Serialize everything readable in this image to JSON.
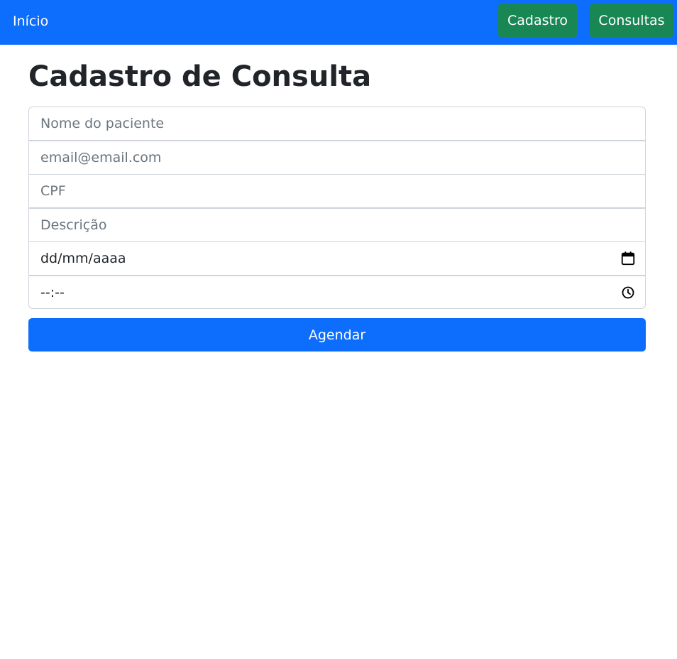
{
  "navbar": {
    "home_label": "Início",
    "cadastro_label": "Cadastro",
    "consultas_label": "Consultas",
    "background_color": "#0d6efd",
    "button_color": "#198754"
  },
  "page": {
    "title": "Cadastro de Consulta"
  },
  "form": {
    "patient_name": {
      "placeholder": "Nome do paciente",
      "value": ""
    },
    "email": {
      "placeholder": "email@email.com",
      "value": ""
    },
    "cpf": {
      "placeholder": "CPF",
      "value": ""
    },
    "description": {
      "placeholder": "Descrição",
      "value": ""
    },
    "date": {
      "display": "dd/mm/aaaa",
      "icon": "calendar-icon"
    },
    "time": {
      "display": "--:--",
      "icon": "clock-icon"
    },
    "submit_label": "Agendar",
    "submit_color": "#0d6efd"
  }
}
